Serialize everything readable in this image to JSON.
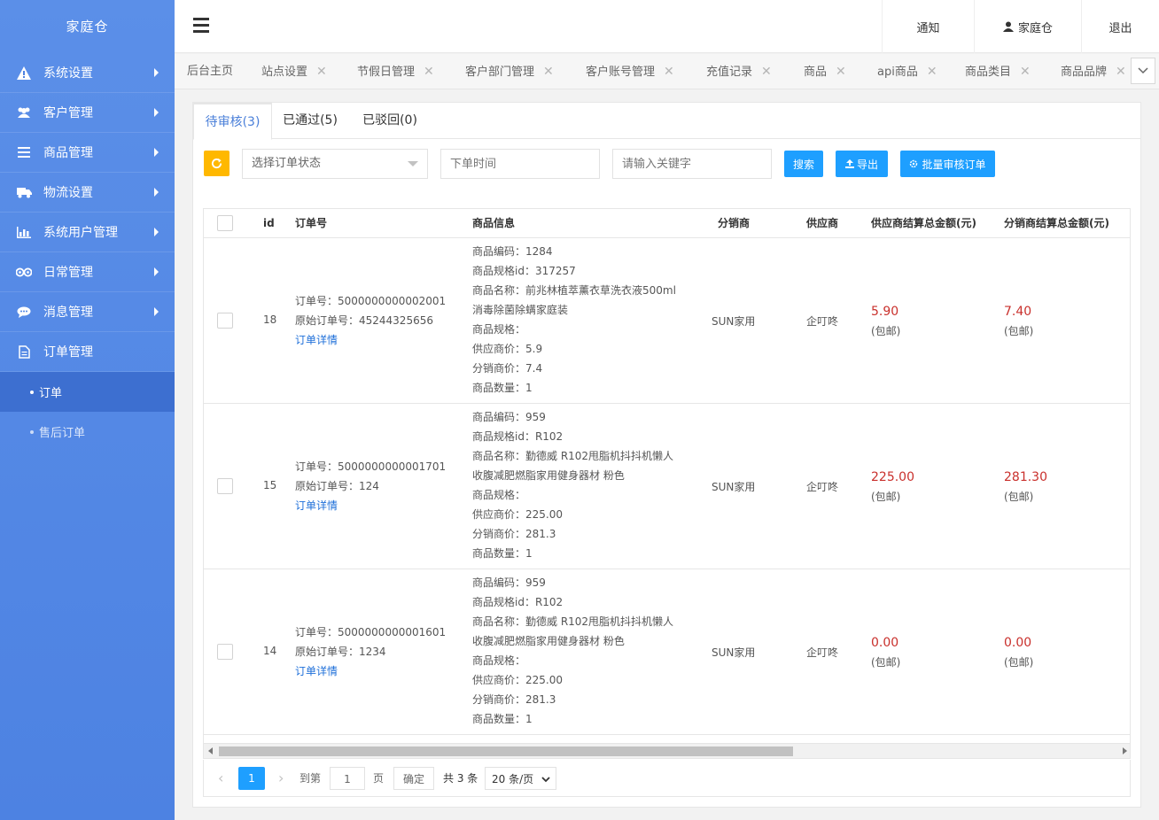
{
  "sidebar": {
    "brand": "家庭仓",
    "menu": [
      {
        "label": "系统设置",
        "icon": "warning-icon"
      },
      {
        "label": "客户管理",
        "icon": "users-icon"
      },
      {
        "label": "商品管理",
        "icon": "list-icon"
      },
      {
        "label": "物流设置",
        "icon": "truck-icon"
      },
      {
        "label": "系统用户管理",
        "icon": "bar-chart-icon"
      },
      {
        "label": "日常管理",
        "icon": "binoculars-icon"
      },
      {
        "label": "消息管理",
        "icon": "chat-icon"
      },
      {
        "label": "订单管理",
        "icon": "document-icon"
      }
    ],
    "submenu": [
      {
        "label": "订单"
      },
      {
        "label": "售后订单"
      }
    ]
  },
  "header": {
    "notify": "通知",
    "user": "家庭仓",
    "logout": "退出"
  },
  "tabs": [
    "后台主页",
    "站点设置",
    "节假日管理",
    "客户部门管理",
    "客户账号管理",
    "充值记录",
    "商品",
    "api商品",
    "商品类目",
    "商品品牌"
  ],
  "subtabs": [
    "待审核(3)",
    "已通过(5)",
    "已驳回(0)"
  ],
  "toolbar": {
    "status_placeholder": "选择订单状态",
    "time_placeholder": "下单时间",
    "keyword_placeholder": "请输入关键字",
    "search": "搜索",
    "export": "导出",
    "batch": "批量审核订单"
  },
  "table": {
    "headers": {
      "id": "id",
      "order_no": "订单号",
      "goods": "商品信息",
      "distributor": "分销商",
      "supplier": "供应商",
      "supplier_total": "供应商结算总金额(元)",
      "distributor_total": "分销商结算总金额(元)"
    },
    "rows": [
      {
        "id": "18",
        "order_no": "订单号：5000000000002001",
        "orig_no": "原始订单号：45244325656",
        "detail": "订单详情",
        "goods": [
          "商品编码：1284",
          "商品规格id：317257",
          "商品名称：前兆林植萃薰衣草洗衣液500ml",
          "消毒除菌除螨家庭装",
          "商品规格：",
          "供应商价：5.9",
          "分销商价：7.4",
          "商品数量：1"
        ],
        "distributor": "SUN家用",
        "supplier": "企叮咚",
        "supplier_total": "5.90",
        "supplier_note": "(包邮)",
        "distributor_total": "7.40",
        "distributor_note": "(包邮)"
      },
      {
        "id": "15",
        "order_no": "订单号：5000000000001701",
        "orig_no": "原始订单号：124",
        "detail": "订单详情",
        "goods": [
          "商品编码：959",
          "商品规格id：R102",
          "商品名称：勤德威 R102甩脂机抖抖机懒人",
          "收腹减肥燃脂家用健身器材 粉色",
          "商品规格：",
          "供应商价：225.00",
          "分销商价：281.3",
          "商品数量：1"
        ],
        "distributor": "SUN家用",
        "supplier": "企叮咚",
        "supplier_total": "225.00",
        "supplier_note": "(包邮)",
        "distributor_total": "281.30",
        "distributor_note": "(包邮)"
      },
      {
        "id": "14",
        "order_no": "订单号：5000000000001601",
        "orig_no": "原始订单号：1234",
        "detail": "订单详情",
        "goods": [
          "商品编码：959",
          "商品规格id：R102",
          "商品名称：勤德威 R102甩脂机抖抖机懒人",
          "收腹减肥燃脂家用健身器材 粉色",
          "商品规格：",
          "供应商价：225.00",
          "分销商价：281.3",
          "商品数量：1"
        ],
        "distributor": "SUN家用",
        "supplier": "企叮咚",
        "supplier_total": "0.00",
        "supplier_note": "(包邮)",
        "distributor_total": "0.00",
        "distributor_note": "(包邮)"
      }
    ]
  },
  "pager": {
    "current": "1",
    "goto": "到第",
    "page_value": "1",
    "page_unit": "页",
    "confirm": "确定",
    "total": "共 3 条",
    "per_page": "20 条/页"
  },
  "colors": {
    "sidebar": "#4d82e2",
    "primary": "#1e9fff",
    "warn": "#ffb800",
    "price": "#c9302c"
  }
}
